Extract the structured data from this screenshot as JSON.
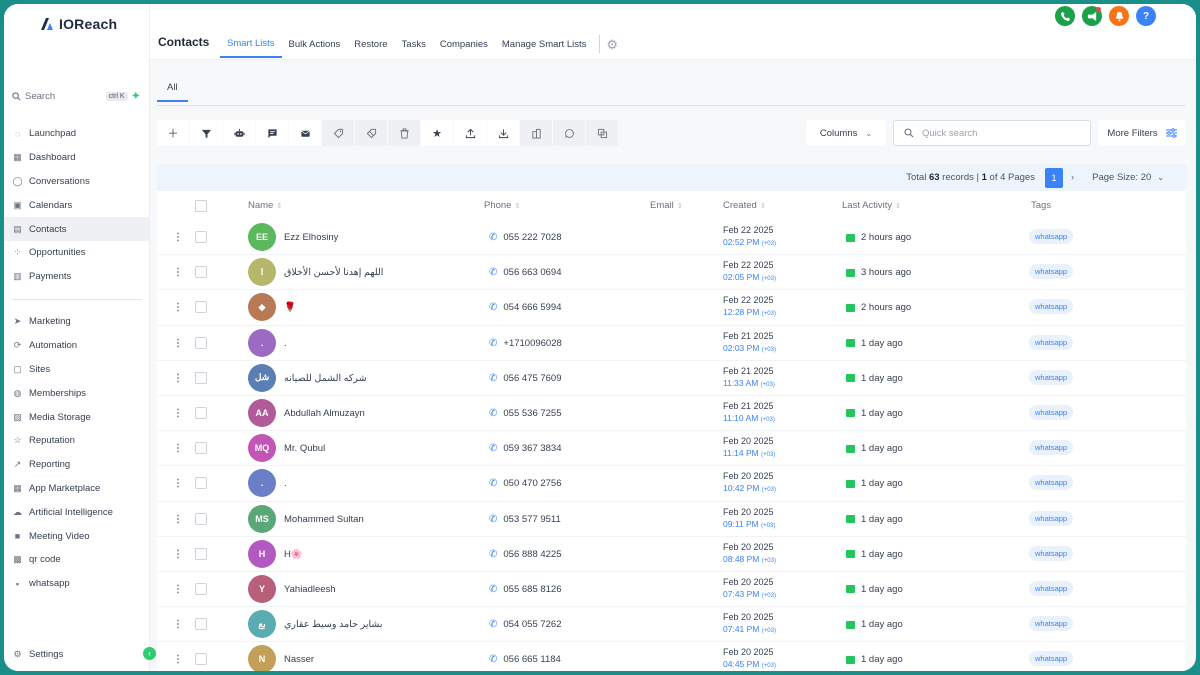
{
  "app": {
    "logo_text": "IOReach"
  },
  "sidebar": {
    "search_label": "Search",
    "search_shortcut": "ctrl K",
    "items_top": [
      {
        "label": "Launchpad",
        "icon": "rocket-icon"
      },
      {
        "label": "Dashboard",
        "icon": "grid-icon"
      },
      {
        "label": "Conversations",
        "icon": "chat-icon"
      },
      {
        "label": "Calendars",
        "icon": "calendar-icon"
      },
      {
        "label": "Contacts",
        "icon": "contacts-icon",
        "active": true
      },
      {
        "label": "Opportunities",
        "icon": "opportunities-icon"
      },
      {
        "label": "Payments",
        "icon": "payments-icon"
      }
    ],
    "items_bottom": [
      {
        "label": "Marketing",
        "icon": "send-icon"
      },
      {
        "label": "Automation",
        "icon": "automation-icon"
      },
      {
        "label": "Sites",
        "icon": "sites-icon"
      },
      {
        "label": "Memberships",
        "icon": "memberships-icon"
      },
      {
        "label": "Media Storage",
        "icon": "media-icon"
      },
      {
        "label": "Reputation",
        "icon": "star-icon"
      },
      {
        "label": "Reporting",
        "icon": "chart-icon"
      },
      {
        "label": "App Marketplace",
        "icon": "apps-icon"
      },
      {
        "label": "Artificial Intelligence",
        "icon": "ai-icon"
      },
      {
        "label": "Meeting Video",
        "icon": "video-icon"
      },
      {
        "label": "qr code",
        "icon": "qr-icon"
      },
      {
        "label": "whatsapp",
        "icon": "whatsapp-icon"
      }
    ],
    "settings_label": "Settings"
  },
  "header": {
    "title": "Contacts",
    "tabs": [
      "Smart Lists",
      "Bulk Actions",
      "Restore",
      "Tasks",
      "Companies",
      "Manage Smart Lists"
    ],
    "help_label": "?"
  },
  "subtabs": {
    "all_label": "All"
  },
  "toolbar": {
    "columns_label": "Columns",
    "search_placeholder": "Quick search",
    "more_filters_label": "More Filters"
  },
  "pager": {
    "prefix": "Total",
    "total": "63",
    "records_text": "records |",
    "page": "1",
    "of_text": "of 4 Pages",
    "current": "1",
    "page_size_label": "Page Size: 20"
  },
  "table": {
    "columns": [
      "Name",
      "Phone",
      "Email",
      "Created",
      "Last Activity",
      "Tags"
    ],
    "rows": [
      {
        "initials": "EE",
        "color": "#5cb85c",
        "name": "Ezz Elhosiny",
        "phone": "055 222 7028",
        "date": "Feb 22 2025",
        "time": "02:52 PM",
        "tz": "(+03)",
        "activity": "2 hours ago",
        "tag": "whatsapp"
      },
      {
        "initials": "ا",
        "color": "#b5b86a",
        "name": "اللهم إهدنا لأحسن الأخلاق",
        "phone": "056 663 0694",
        "date": "Feb 22 2025",
        "time": "02:05 PM",
        "tz": "(+03)",
        "activity": "3 hours ago",
        "tag": "whatsapp"
      },
      {
        "initials": "◆",
        "color": "#b87a55",
        "name": "🌹",
        "phone": "054 666 5994",
        "date": "Feb 22 2025",
        "time": "12:28 PM",
        "tz": "(+03)",
        "activity": "2 hours ago",
        "tag": "whatsapp"
      },
      {
        "initials": ".",
        "color": "#9b6bc4",
        "name": ".",
        "phone": "+1710096028",
        "date": "Feb 21 2025",
        "time": "02:03 PM",
        "tz": "(+03)",
        "activity": "1 day ago",
        "tag": "whatsapp"
      },
      {
        "initials": "شل",
        "color": "#5a7fb5",
        "name": "شركه الشمل للصيانه",
        "phone": "056 475 7609",
        "date": "Feb 21 2025",
        "time": "11:33 AM",
        "tz": "(+03)",
        "activity": "1 day ago",
        "tag": "whatsapp"
      },
      {
        "initials": "AA",
        "color": "#b05a9a",
        "name": "Abdullah Almuzayn",
        "phone": "055 536 7255",
        "date": "Feb 21 2025",
        "time": "11:10 AM",
        "tz": "(+03)",
        "activity": "1 day ago",
        "tag": "whatsapp"
      },
      {
        "initials": "MQ",
        "color": "#c255b5",
        "name": "Mr. Qubul",
        "phone": "059 367 3834",
        "date": "Feb 20 2025",
        "time": "11:14 PM",
        "tz": "(+03)",
        "activity": "1 day ago",
        "tag": "whatsapp"
      },
      {
        "initials": ".",
        "color": "#6b7fc9",
        "name": ".",
        "phone": "050 470 2756",
        "date": "Feb 20 2025",
        "time": "10:42 PM",
        "tz": "(+03)",
        "activity": "1 day ago",
        "tag": "whatsapp"
      },
      {
        "initials": "MS",
        "color": "#5aa878",
        "name": "Mohammed Sultan",
        "phone": "053 577 9511",
        "date": "Feb 20 2025",
        "time": "09:11 PM",
        "tz": "(+03)",
        "activity": "1 day ago",
        "tag": "whatsapp"
      },
      {
        "initials": "H",
        "color": "#b35ac2",
        "name": "H🌸",
        "phone": "056 888 4225",
        "date": "Feb 20 2025",
        "time": "08:48 PM",
        "tz": "(+03)",
        "activity": "1 day ago",
        "tag": "whatsapp"
      },
      {
        "initials": "Y",
        "color": "#b8607a",
        "name": "Yahiadleesh",
        "phone": "055 685 8126",
        "date": "Feb 20 2025",
        "time": "07:43 PM",
        "tz": "(+03)",
        "activity": "1 day ago",
        "tag": "whatsapp"
      },
      {
        "initials": "بع",
        "color": "#5aacb0",
        "name": "بشاير حامد وسيط عقاري",
        "phone": "054 055 7262",
        "date": "Feb 20 2025",
        "time": "07:41 PM",
        "tz": "(+03)",
        "activity": "1 day ago",
        "tag": "whatsapp"
      },
      {
        "initials": "N",
        "color": "#c2a05a",
        "name": "Nasser",
        "phone": "056 665 1184",
        "date": "Feb 20 2025",
        "time": "04:45 PM",
        "tz": "(+03)",
        "activity": "1 day ago",
        "tag": "whatsapp"
      }
    ]
  },
  "colors": {
    "accent": "#3b82f6",
    "phone_icon": "#1aa14a",
    "megaphone_icon": "#1aa14a",
    "bell_icon": "#f97316",
    "help_icon": "#3b82f6"
  }
}
